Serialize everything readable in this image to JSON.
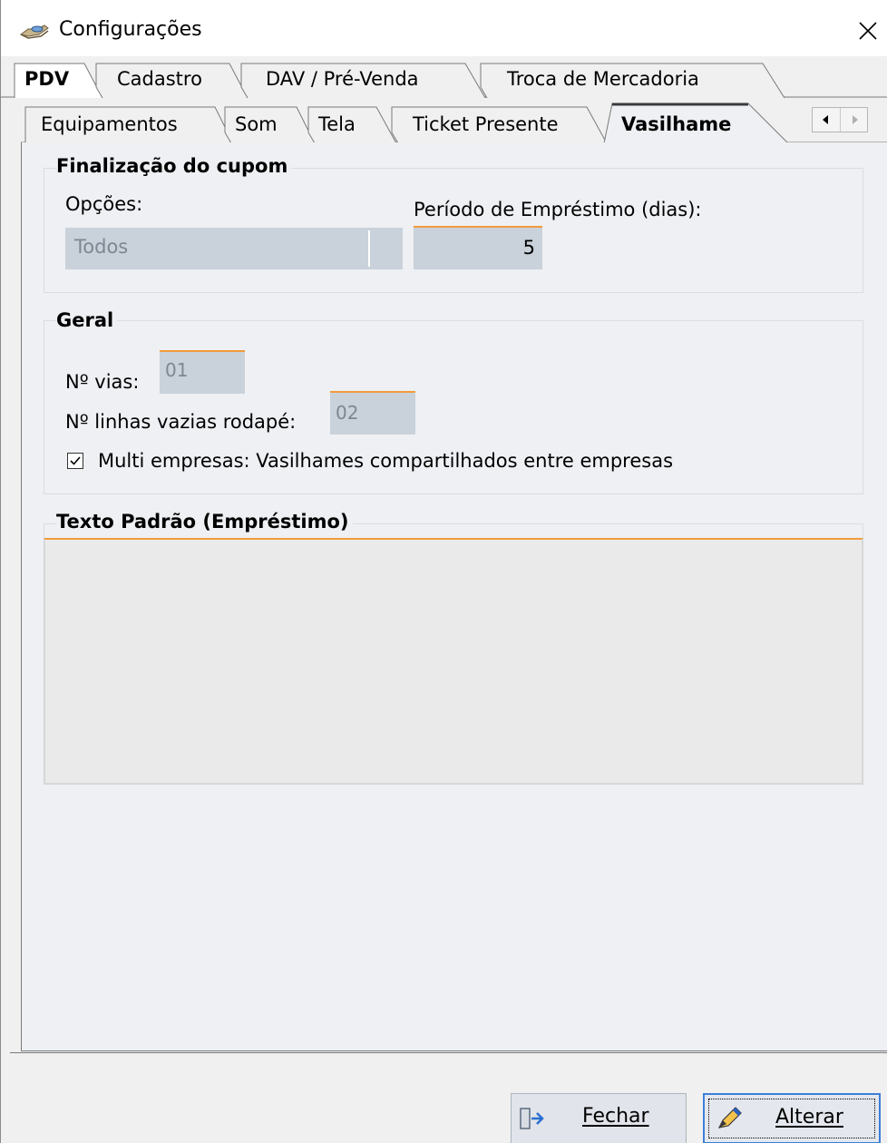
{
  "window": {
    "title": "Configurações",
    "icons": {
      "app": "hand-coin-icon",
      "close": "close-icon"
    }
  },
  "tabs_main": [
    {
      "label": "PDV",
      "active": true
    },
    {
      "label": "Cadastro",
      "active": false
    },
    {
      "label": "DAV / Pré-Venda",
      "active": false
    },
    {
      "label": "Troca de Mercadoria",
      "active": false
    }
  ],
  "tabs_sub": [
    {
      "label": "Equipamentos",
      "active": false
    },
    {
      "label": "Som",
      "active": false
    },
    {
      "label": "Tela",
      "active": false
    },
    {
      "label": "Ticket Presente",
      "active": false
    },
    {
      "label": "Vasilhame",
      "active": true
    }
  ],
  "tab_scroll": {
    "left_icon": "arrow-left-icon",
    "right_icon": "arrow-right-icon"
  },
  "finalizacao": {
    "title": "Finalização do cupom",
    "opcoes_label": "Opções:",
    "opcoes_value": "Todos",
    "periodo_label": "Período de Empréstimo (dias):",
    "periodo_value": "5"
  },
  "geral": {
    "title": "Geral",
    "vias_label": "Nº vias:",
    "vias_value": "01",
    "linhas_label": "Nº linhas vazias rodapé:",
    "linhas_value": "02",
    "multi_label": "Multi empresas: Vasilhames compartilhados entre empresas",
    "multi_checked": true
  },
  "texto_padrao": {
    "title": "Texto Padrão (Empréstimo)",
    "value": ""
  },
  "buttons": {
    "fechar": {
      "label": "Fechar",
      "icon": "exit-door-icon"
    },
    "alterar": {
      "label": "Alterar",
      "icon": "pencil-icon"
    }
  },
  "colors": {
    "accent_orange": "#f29a3c",
    "field_bg": "#c9d1da",
    "focus_blue": "#3c7fd8"
  }
}
